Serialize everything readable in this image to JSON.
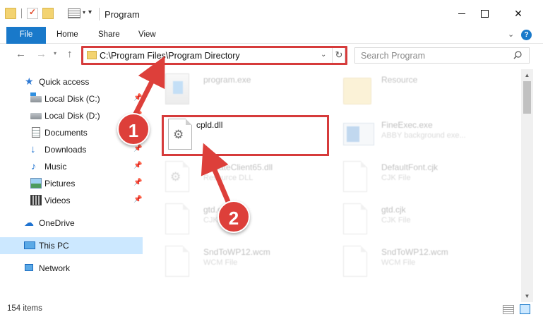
{
  "window": {
    "title": "Program",
    "controls": {
      "minimize": "minimize",
      "maximize": "maximize",
      "close": "✕"
    }
  },
  "ribbon": {
    "tabs": [
      "File",
      "Home",
      "Share",
      "View"
    ],
    "help_label": "?"
  },
  "navigation": {
    "address_path": "C:\\Program Files\\Program Directory",
    "search_placeholder": "Search Program"
  },
  "sidebar": {
    "items": [
      {
        "label": "Quick access",
        "icon": "star-icon",
        "pinned": false
      },
      {
        "label": "Local Disk (C:)",
        "icon": "disk-icon",
        "pinned": true
      },
      {
        "label": "Local Disk (D:)",
        "icon": "disk-icon",
        "pinned": true
      },
      {
        "label": "Documents",
        "icon": "documents-icon",
        "pinned": true
      },
      {
        "label": "Downloads",
        "icon": "download-icon",
        "pinned": true
      },
      {
        "label": "Music",
        "icon": "music-icon",
        "pinned": true
      },
      {
        "label": "Pictures",
        "icon": "pictures-icon",
        "pinned": true
      },
      {
        "label": "Videos",
        "icon": "videos-icon",
        "pinned": true
      },
      {
        "label": "OneDrive",
        "icon": "cloud-icon",
        "pinned": false
      },
      {
        "label": "This PC",
        "icon": "computer-icon",
        "pinned": false,
        "selected": true
      },
      {
        "label": "Network",
        "icon": "network-icon",
        "pinned": false
      }
    ]
  },
  "files": [
    {
      "name": "program.exe",
      "subtitle": "",
      "icon": "exe-icon",
      "highlighted": false
    },
    {
      "name": "Resource",
      "subtitle": "",
      "icon": "folder-icon",
      "highlighted": false
    },
    {
      "name": "cpld.dll",
      "subtitle": "",
      "icon": "dll-gear-icon",
      "highlighted": true
    },
    {
      "name": "FineExec.exe",
      "subtitle": "ABBY background exe...",
      "icon": "app-icon",
      "highlighted": false
    },
    {
      "name": "UpdateClient65.dll",
      "subtitle": "Resource DLL",
      "icon": "dll-gear-icon",
      "highlighted": false
    },
    {
      "name": "DefaultFont.cjk",
      "subtitle": "CJK File",
      "icon": "document-icon",
      "highlighted": false
    },
    {
      "name": "gtd.cjk",
      "subtitle": "CJK File",
      "icon": "document-icon",
      "highlighted": false
    },
    {
      "name": "gtd.cjk",
      "subtitle": "CJK File",
      "icon": "document-icon",
      "highlighted": false
    },
    {
      "name": "SndToWP12.wcm",
      "subtitle": "WCM File",
      "icon": "document-icon",
      "highlighted": false
    },
    {
      "name": "SndToWP12.wcm",
      "subtitle": "WCM File",
      "icon": "document-icon",
      "highlighted": false
    }
  ],
  "callouts": {
    "step1": "1",
    "step2": "2"
  },
  "status": {
    "item_count": "154 items"
  },
  "colors": {
    "accent": "#1979ca",
    "callout": "#dd3f3a",
    "selection": "#cce8ff"
  }
}
